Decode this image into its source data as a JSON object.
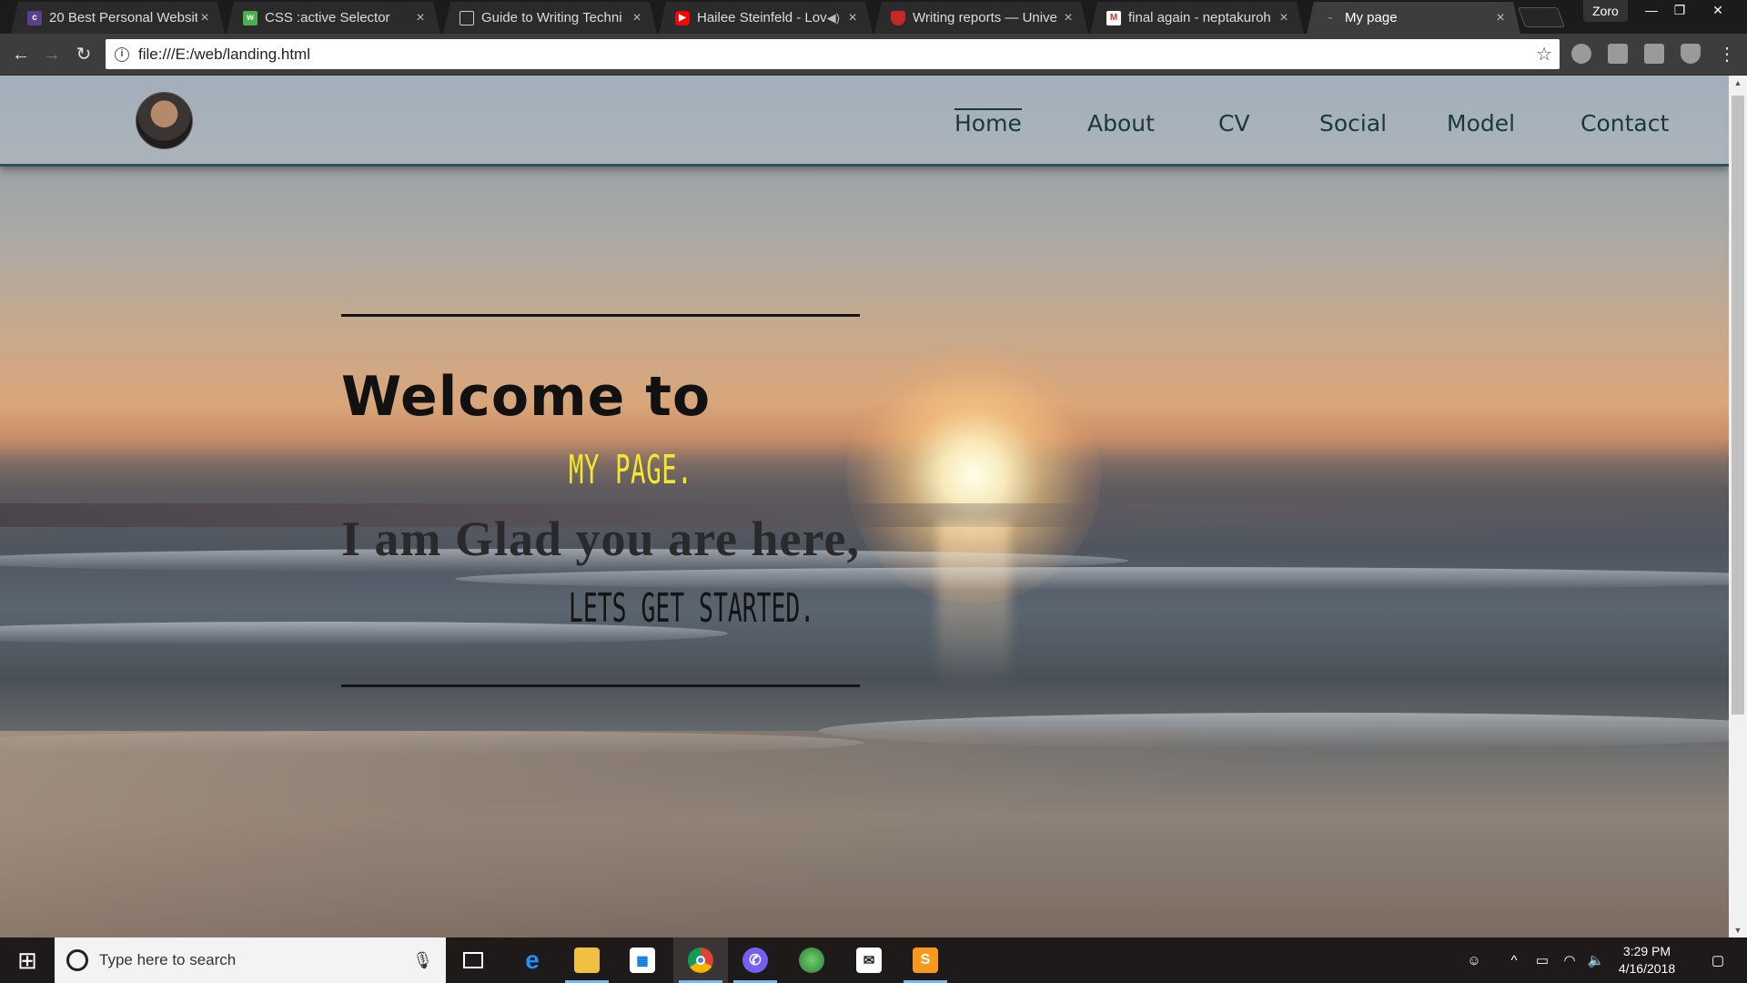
{
  "browser": {
    "tabs": [
      {
        "title": "20 Best Personal Websit",
        "icon": "colorlib-icon",
        "color": "#5b3f8f"
      },
      {
        "title": "CSS :active Selector",
        "icon": "w3schools-icon",
        "color": "#4caf50"
      },
      {
        "title": "Guide to Writing Techni",
        "icon": "document-icon",
        "color": "#2b2b2b"
      },
      {
        "title": "Hailee Steinfeld - Lov",
        "icon": "youtube-icon",
        "color": "#ff0000"
      },
      {
        "title": "Writing reports — Unive",
        "icon": "university-shield-icon",
        "color": "#c62828"
      },
      {
        "title": "final again - neptakuroh",
        "icon": "gmail-icon",
        "color": "#d93025"
      },
      {
        "title": "My page",
        "icon": "page-icon",
        "color": "#3d3d3d"
      }
    ],
    "profile_name": "Zoro",
    "url": "file:///E:/web/landing.html"
  },
  "site": {
    "nav": [
      {
        "label": "Home",
        "active": true
      },
      {
        "label": "About"
      },
      {
        "label": "CV"
      },
      {
        "label": "Social"
      },
      {
        "label": "Model"
      },
      {
        "label": "Contact"
      }
    ],
    "hero": {
      "welcome": "Welcome to",
      "brand": "MY PAGE.",
      "glad": "I am Glad you are here,",
      "started": "LETS GET STARTED."
    },
    "colors": {
      "accent_yellow": "#f5e82a",
      "nav_text": "#17393d",
      "header_border": "#2f5356"
    }
  },
  "taskbar": {
    "search_placeholder": "Type here to search",
    "apps": [
      "task-view-icon",
      "edge-icon",
      "file-explorer-icon",
      "store-icon",
      "chrome-icon",
      "viber-icon",
      "globe-app-icon",
      "mail-icon",
      "sublime-text-icon"
    ],
    "time": "3:29 PM",
    "date": "4/16/2018"
  }
}
